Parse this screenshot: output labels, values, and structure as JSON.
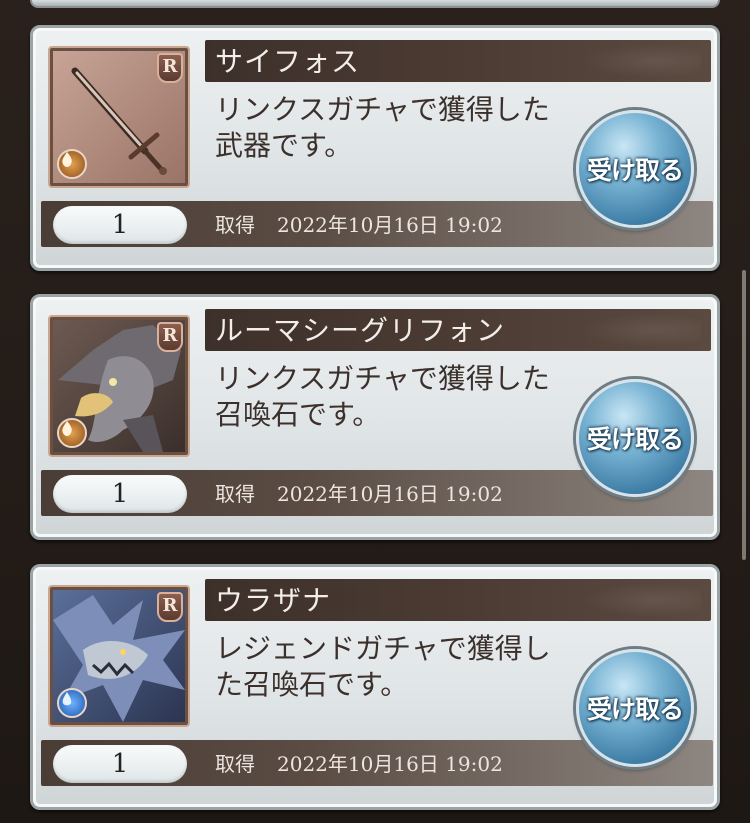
{
  "receive_label": "受け取る",
  "acquired_label": "取得",
  "rarity_letter": "R",
  "colors": {
    "name_bar": "#3d302a",
    "receive_button": "#4d8cb6",
    "fire_element": "#c7823f",
    "water_element": "#3a7ad8"
  },
  "items": [
    {
      "name": "サイフォス",
      "description": "リンクスガチャで獲得した武器です。",
      "quantity": "1",
      "date": "2022年10月16日 19:02",
      "thumbnail_icon": "sword-icon",
      "element_icon": "fire-element-icon"
    },
    {
      "name": "ルーマシーグリフォン",
      "description": "リンクスガチャで獲得した召喚石です。",
      "quantity": "1",
      "date": "2022年10月16日 19:02",
      "thumbnail_icon": "griffon-icon",
      "element_icon": "wind-element-icon"
    },
    {
      "name": "ウラザナ",
      "description": "レジェンドガチャで獲得した召喚石です。",
      "quantity": "1",
      "date": "2022年10月16日 19:02",
      "thumbnail_icon": "sea-dragon-icon",
      "element_icon": "water-element-icon"
    }
  ]
}
